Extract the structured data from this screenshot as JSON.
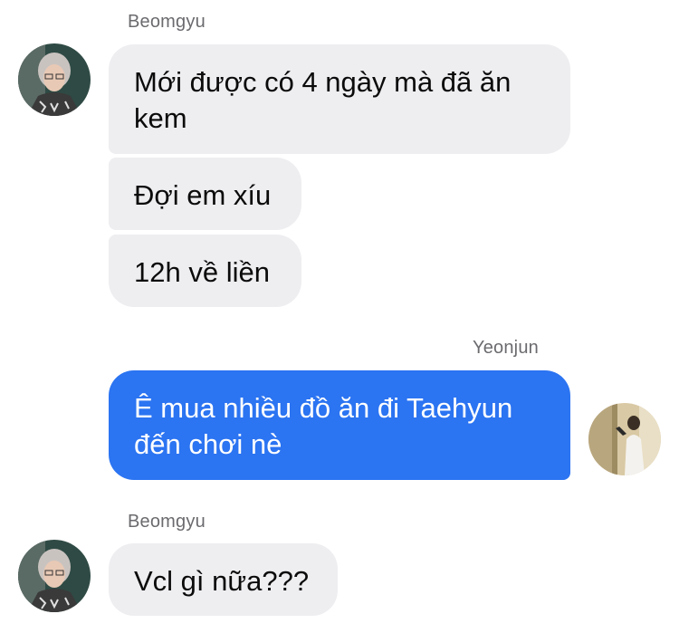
{
  "conversation": {
    "groups": [
      {
        "sender": "Beomgyu",
        "direction": "incoming",
        "messages": [
          "Mới được có 4 ngày mà đã ăn kem",
          "Đợi em xíu",
          "12h về liền"
        ]
      },
      {
        "sender": "Yeonjun",
        "direction": "outgoing",
        "messages": [
          "Ê mua nhiều đồ ăn đi Taehyun đến chơi nè"
        ]
      },
      {
        "sender": "Beomgyu",
        "direction": "incoming",
        "messages": [
          "Vcl gì nữa???"
        ]
      }
    ]
  },
  "colors": {
    "incoming_bubble": "#eeeef1",
    "outgoing_bubble": "#2b74f2",
    "sender_name": "#6b6b6f"
  },
  "icons": {
    "incoming_avatar": "avatar-photo-beomgyu",
    "outgoing_avatar": "avatar-photo-yeonjun"
  }
}
